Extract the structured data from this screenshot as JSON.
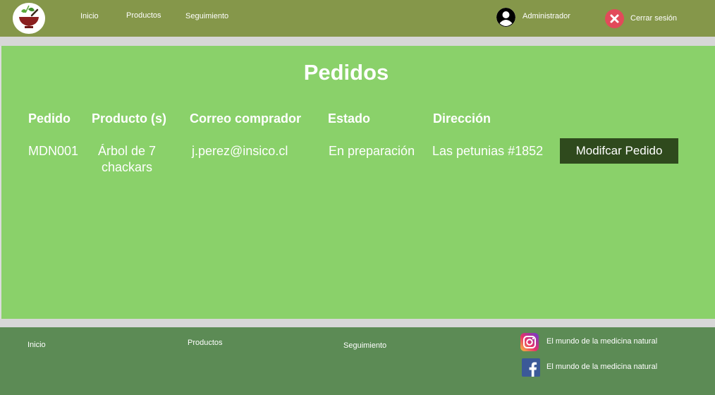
{
  "nav": {
    "inicio": "Inicio",
    "productos": "Productos",
    "seguimiento": "Seguimiento"
  },
  "user": {
    "name": "Administrador",
    "logout": "Cerrar sesión"
  },
  "page": {
    "title": "Pedidos"
  },
  "table": {
    "headers": [
      "Pedido",
      "Producto (s)",
      "Correo comprador",
      "Estado",
      "Dirección"
    ],
    "rows": [
      {
        "pedido": "MDN001",
        "producto_line1": "Árbol de 7",
        "producto_line2": "chackars",
        "correo": "j.perez@insico.cl",
        "estado": "En preparación",
        "direccion": "Las petunias #1852",
        "action": "Modifcar Pedido"
      }
    ]
  },
  "footer": {
    "inicio": "Inicio",
    "productos": "Productos",
    "seguimiento": "Seguimiento",
    "instagram_text": "El mundo de la medicina natural",
    "facebook_text": "El mundo de la medicina natural"
  },
  "icons": {
    "logo": "mortar-herbs-logo",
    "user": "user-avatar-icon",
    "logout": "close-circle-icon",
    "instagram": "instagram-icon",
    "facebook": "facebook-icon"
  },
  "colors": {
    "topbar": "#85974a",
    "main": "#8ad16a",
    "footer": "#5c8b55",
    "button": "#2f4a1d",
    "logout": "#e24a5a"
  }
}
